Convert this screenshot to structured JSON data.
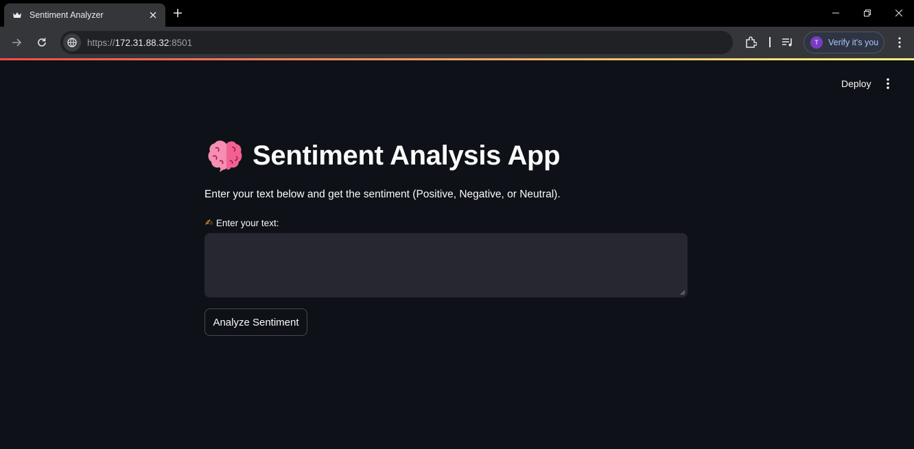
{
  "browser": {
    "tab_title": "Sentiment Analyzer",
    "url_scheme": "https://",
    "url_host": "172.31.88.32",
    "url_port": ":8501",
    "profile_initial": "T",
    "profile_label": "Verify it's you"
  },
  "colors": {
    "background": "#0e1117",
    "input_background": "#262730",
    "decoration_start": "#ff4b4b",
    "decoration_end": "#fffd80"
  },
  "app": {
    "deploy_label": "Deploy",
    "title": "Sentiment Analysis App",
    "title_icon": "brain-icon",
    "subtitle": "Enter your text below and get the sentiment (Positive, Negative, or Neutral).",
    "input_label_icon": "writing-hand-icon",
    "input_label": "Enter your text:",
    "input_value": "",
    "button_label": "Analyze Sentiment"
  }
}
